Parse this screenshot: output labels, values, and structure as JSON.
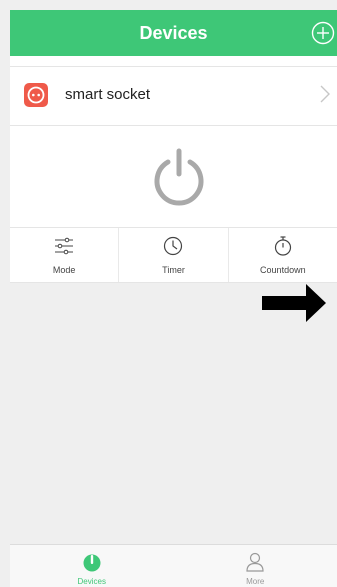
{
  "header": {
    "title": "Devices"
  },
  "device": {
    "name": "smart socket"
  },
  "actions": [
    {
      "label": "Mode"
    },
    {
      "label": "Timer"
    },
    {
      "label": "Countdown"
    }
  ],
  "tabs": [
    {
      "label": "Devices",
      "active": true
    },
    {
      "label": "More",
      "active": false
    }
  ],
  "colors": {
    "accent": "#3ec777",
    "socket": "#ef5a4a",
    "power": "#a9a9a9",
    "background": "#efefef"
  },
  "icons": {
    "header": "add-circle-icon",
    "device": "smart-socket-icon",
    "row": "chevron-right-icon",
    "power": "power-icon",
    "mode": "sliders-icon",
    "timer": "clock-icon",
    "countdown": "stopwatch-icon",
    "arrow": "arrow-right-icon",
    "devices_tab": "power-plug-icon",
    "more_tab": "user-icon"
  }
}
